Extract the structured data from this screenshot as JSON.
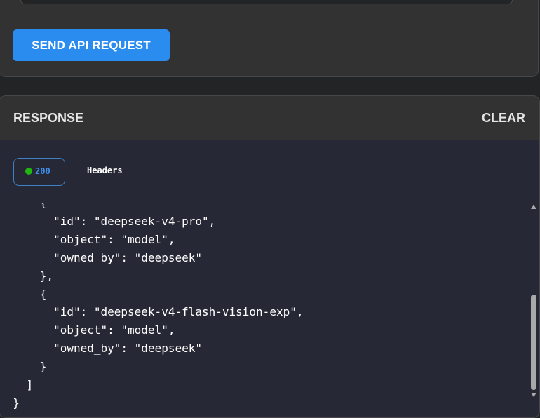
{
  "request": {
    "send_label": "SEND API REQUEST"
  },
  "response": {
    "title": "RESPONSE",
    "clear_label": "CLEAR",
    "status_code": "200",
    "status_color": "#1fb80e",
    "headers_tab_label": "Headers",
    "body_lines": [
      "      {",
      "        \"id\": \"deepseek-v4-pro\",",
      "        \"object\": \"model\",",
      "        \"owned_by\": \"deepseek\"",
      "      },",
      "      {",
      "        \"id\": \"deepseek-v4-flash-vision-exp\",",
      "        \"object\": \"model\",",
      "        \"owned_by\": \"deepseek\"",
      "      }",
      "    ]",
      "  }"
    ]
  },
  "colors": {
    "accent": "#2b8cf0",
    "panel": "#323232",
    "code_background": "#262835"
  }
}
